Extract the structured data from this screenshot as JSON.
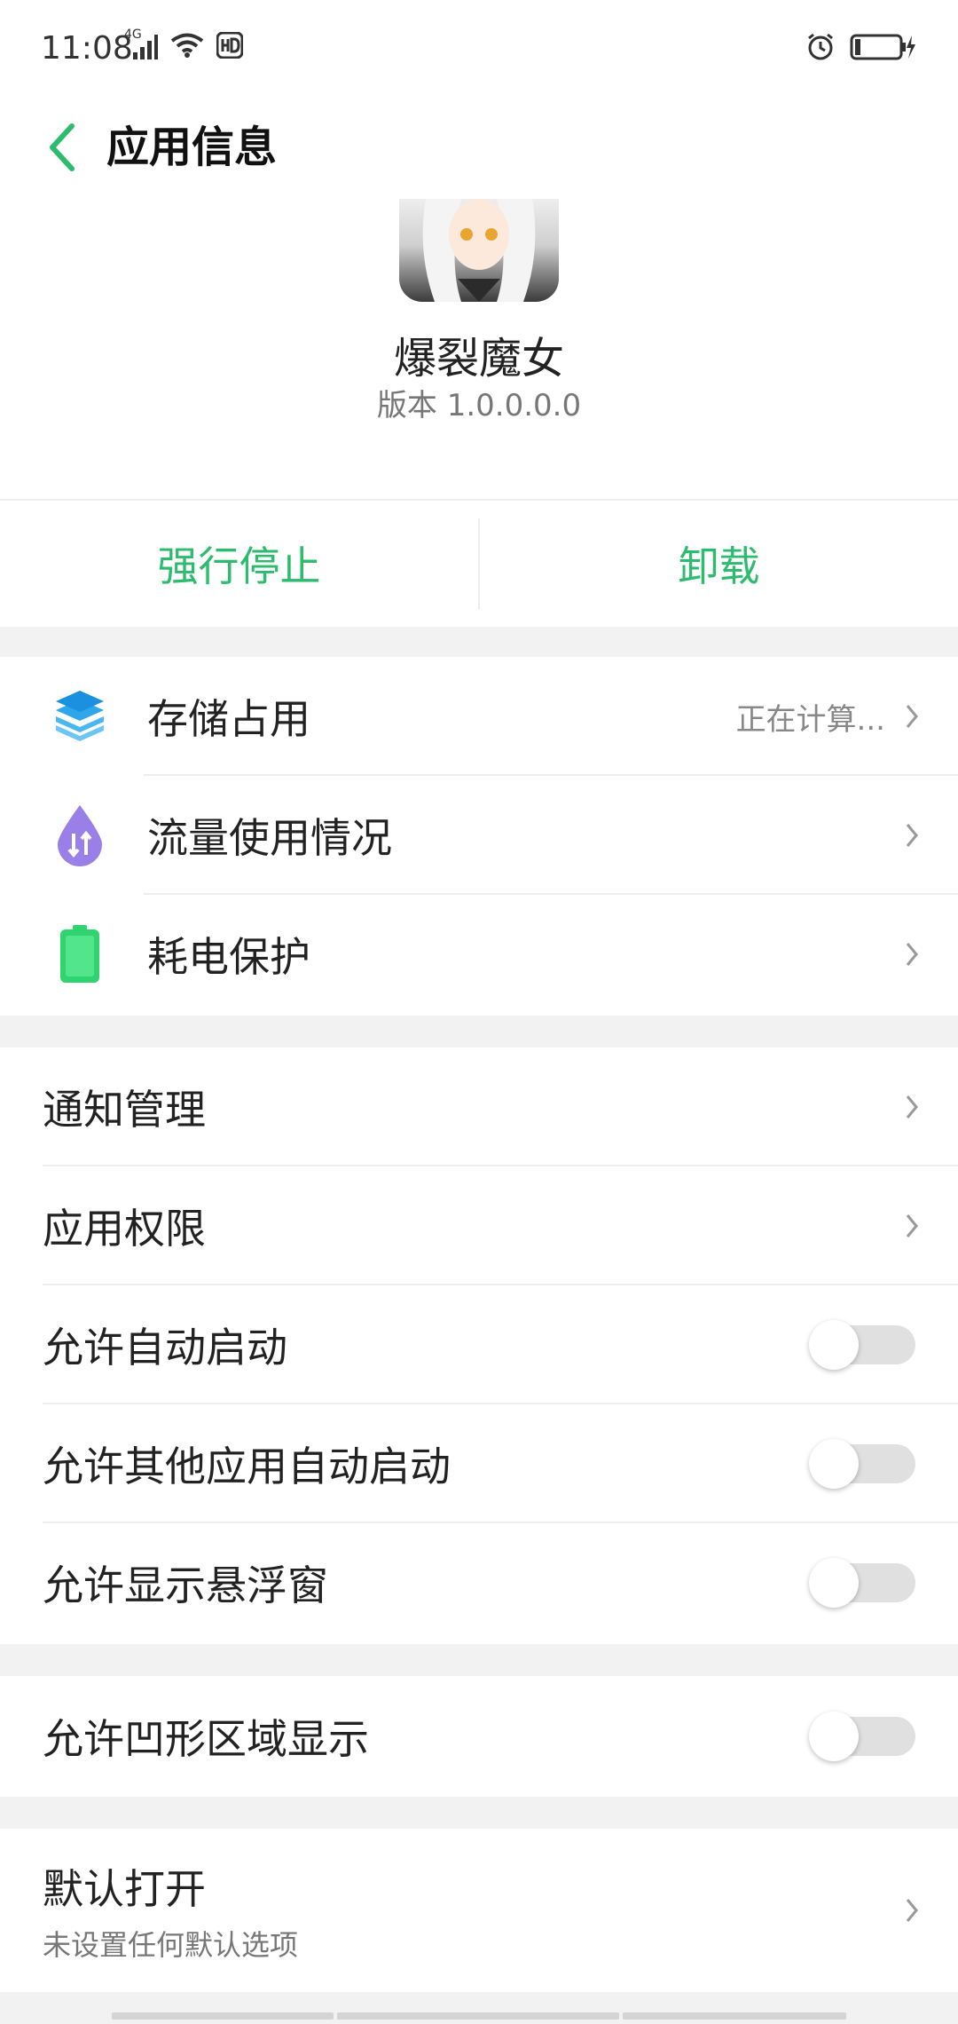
{
  "status_bar": {
    "time": "11:08",
    "network": "4G"
  },
  "title_bar": {
    "title": "应用信息"
  },
  "app": {
    "name": "爆裂魔女",
    "version": "版本 1.0.0.0.0"
  },
  "actions": {
    "force_stop": "强行停止",
    "uninstall": "卸载"
  },
  "usage_section": {
    "storage": {
      "label": "存储占用",
      "value": "正在计算..."
    },
    "data": {
      "label": "流量使用情况"
    },
    "battery": {
      "label": "耗电保护"
    }
  },
  "settings_section": {
    "notifications": {
      "label": "通知管理"
    },
    "permissions": {
      "label": "应用权限"
    },
    "auto_start": {
      "label": "允许自动启动",
      "enabled": false
    },
    "other_auto_start": {
      "label": "允许其他应用自动启动",
      "enabled": false
    },
    "floating_window": {
      "label": "允许显示悬浮窗",
      "enabled": false
    }
  },
  "notch_section": {
    "notch_display": {
      "label": "允许凹形区域显示",
      "enabled": false
    }
  },
  "default_section": {
    "open_by_default": {
      "label": "默认打开",
      "subtitle": "未设置任何默认选项"
    }
  },
  "colors": {
    "accent": "#2dbb6e",
    "toggle_off": "#e0e0e0"
  }
}
